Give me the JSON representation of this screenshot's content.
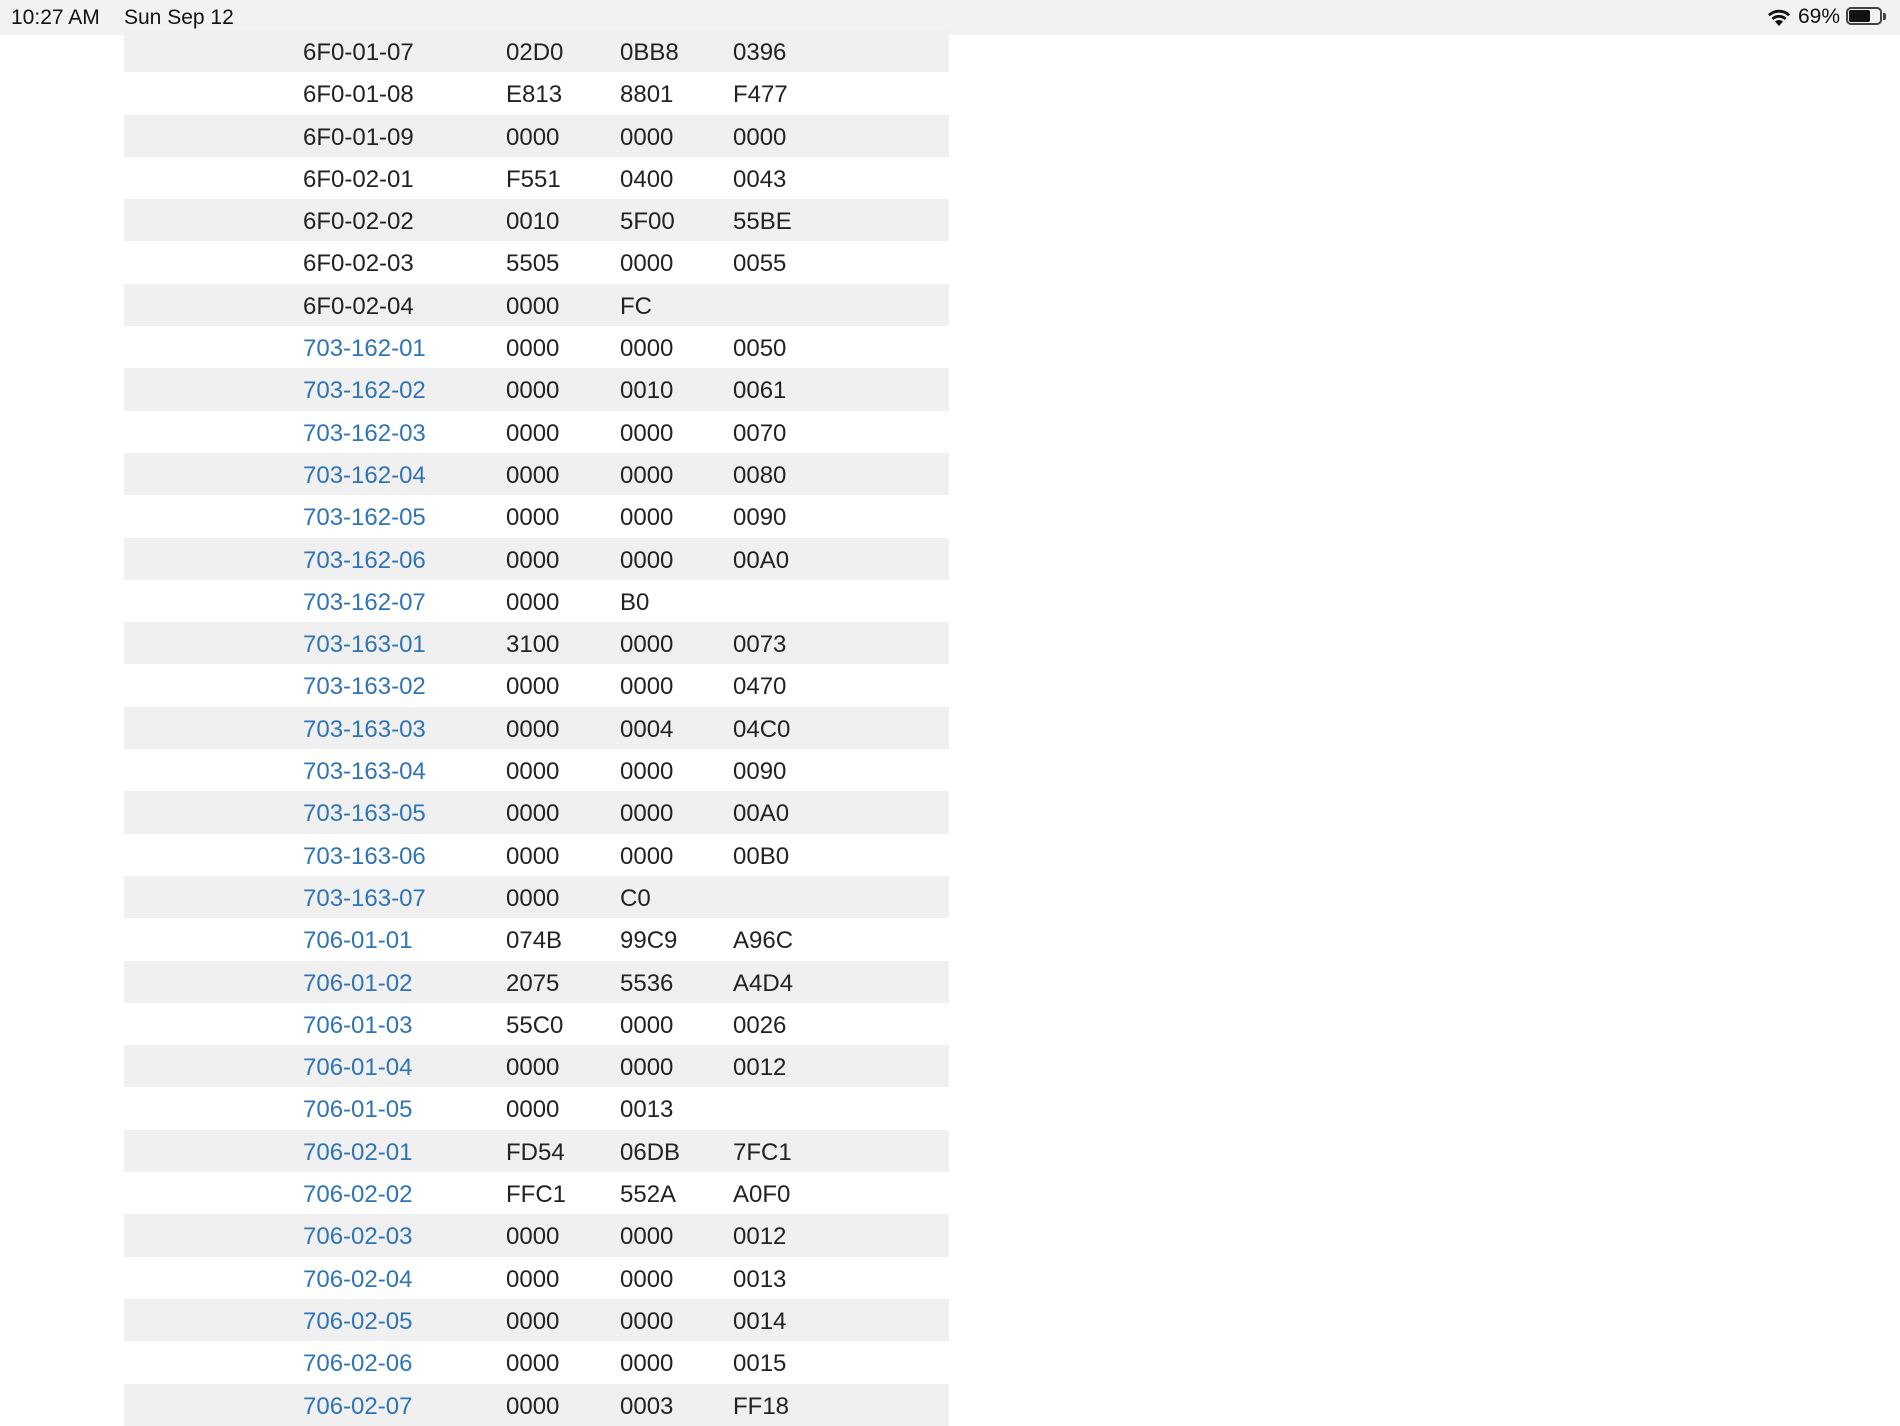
{
  "status_bar": {
    "time": "10:27 AM",
    "date": "Sun Sep 12",
    "battery_percent": "69%",
    "battery_level": 0.69,
    "icons": [
      "wifi-icon",
      "battery-icon"
    ]
  },
  "colors": {
    "link": "#2f74b5",
    "stripe": "#f0f0f0",
    "text": "#222222"
  },
  "table": {
    "rows": [
      {
        "id": "6F0-01-07",
        "link": false,
        "a": "02D0",
        "b": "0BB8",
        "c": "0396"
      },
      {
        "id": "6F0-01-08",
        "link": false,
        "a": "E813",
        "b": "8801",
        "c": "F477"
      },
      {
        "id": "6F0-01-09",
        "link": false,
        "a": "0000",
        "b": "0000",
        "c": "0000"
      },
      {
        "id": "6F0-02-01",
        "link": false,
        "a": "F551",
        "b": "0400",
        "c": "0043"
      },
      {
        "id": "6F0-02-02",
        "link": false,
        "a": "0010",
        "b": "5F00",
        "c": "55BE"
      },
      {
        "id": "6F0-02-03",
        "link": false,
        "a": "5505",
        "b": "0000",
        "c": "0055"
      },
      {
        "id": "6F0-02-04",
        "link": false,
        "a": "0000",
        "b": "FC",
        "c": ""
      },
      {
        "id": "703-162-01",
        "link": true,
        "a": "0000",
        "b": "0000",
        "c": "0050"
      },
      {
        "id": "703-162-02",
        "link": true,
        "a": "0000",
        "b": "0010",
        "c": "0061"
      },
      {
        "id": "703-162-03",
        "link": true,
        "a": "0000",
        "b": "0000",
        "c": "0070"
      },
      {
        "id": "703-162-04",
        "link": true,
        "a": "0000",
        "b": "0000",
        "c": "0080"
      },
      {
        "id": "703-162-05",
        "link": true,
        "a": "0000",
        "b": "0000",
        "c": "0090"
      },
      {
        "id": "703-162-06",
        "link": true,
        "a": "0000",
        "b": "0000",
        "c": "00A0"
      },
      {
        "id": "703-162-07",
        "link": true,
        "a": "0000",
        "b": "B0",
        "c": ""
      },
      {
        "id": "703-163-01",
        "link": true,
        "a": "3100",
        "b": "0000",
        "c": "0073"
      },
      {
        "id": "703-163-02",
        "link": true,
        "a": "0000",
        "b": "0000",
        "c": "0470"
      },
      {
        "id": "703-163-03",
        "link": true,
        "a": "0000",
        "b": "0004",
        "c": "04C0"
      },
      {
        "id": "703-163-04",
        "link": true,
        "a": "0000",
        "b": "0000",
        "c": "0090"
      },
      {
        "id": "703-163-05",
        "link": true,
        "a": "0000",
        "b": "0000",
        "c": "00A0"
      },
      {
        "id": "703-163-06",
        "link": true,
        "a": "0000",
        "b": "0000",
        "c": "00B0"
      },
      {
        "id": "703-163-07",
        "link": true,
        "a": "0000",
        "b": "C0",
        "c": ""
      },
      {
        "id": "706-01-01",
        "link": true,
        "a": "074B",
        "b": "99C9",
        "c": "A96C"
      },
      {
        "id": "706-01-02",
        "link": true,
        "a": "2075",
        "b": "5536",
        "c": "A4D4"
      },
      {
        "id": "706-01-03",
        "link": true,
        "a": "55C0",
        "b": "0000",
        "c": "0026"
      },
      {
        "id": "706-01-04",
        "link": true,
        "a": "0000",
        "b": "0000",
        "c": "0012"
      },
      {
        "id": "706-01-05",
        "link": true,
        "a": "0000",
        "b": "0013",
        "c": ""
      },
      {
        "id": "706-02-01",
        "link": true,
        "a": "FD54",
        "b": "06DB",
        "c": "7FC1"
      },
      {
        "id": "706-02-02",
        "link": true,
        "a": "FFC1",
        "b": "552A",
        "c": "A0F0"
      },
      {
        "id": "706-02-03",
        "link": true,
        "a": "0000",
        "b": "0000",
        "c": "0012"
      },
      {
        "id": "706-02-04",
        "link": true,
        "a": "0000",
        "b": "0000",
        "c": "0013"
      },
      {
        "id": "706-02-05",
        "link": true,
        "a": "0000",
        "b": "0000",
        "c": "0014"
      },
      {
        "id": "706-02-06",
        "link": true,
        "a": "0000",
        "b": "0000",
        "c": "0015"
      },
      {
        "id": "706-02-07",
        "link": true,
        "a": "0000",
        "b": "0003",
        "c": "FF18"
      }
    ]
  }
}
